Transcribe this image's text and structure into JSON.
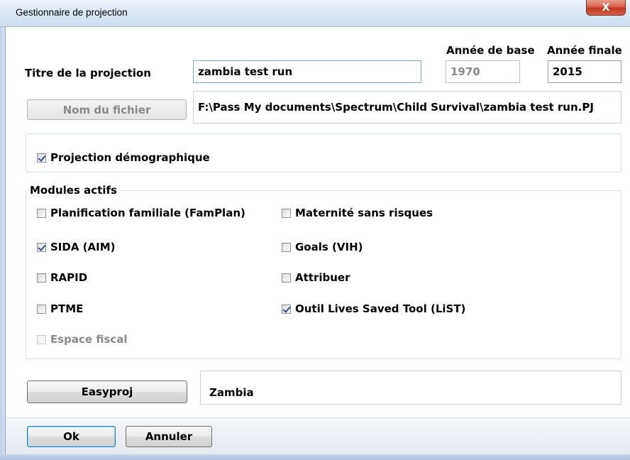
{
  "window": {
    "title": "Gestionnaire de projection",
    "close_glyph": "X"
  },
  "labels": {
    "projection_title": "Titre de la projection",
    "base_year": "Année de base",
    "final_year": "Année finale",
    "modules_group": "Modules actifs"
  },
  "fields": {
    "projection_title": "zambia test run",
    "base_year": "1970",
    "final_year": "2015",
    "file_path": "F:\\Pass My documents\\Spectrum\\Child Survival\\zambia test run.PJ",
    "country": "Zambia"
  },
  "buttons": {
    "file_name": "Nom du fichier",
    "easyproj": "Easyproj",
    "ok": "Ok",
    "cancel": "Annuler"
  },
  "demographic": {
    "label": "Projection démographique",
    "checked": true
  },
  "modules": {
    "famplan": {
      "label": "Planification familiale (FamPlan)",
      "checked": false
    },
    "aim": {
      "label": "SIDA (AIM)",
      "checked": true
    },
    "rapid": {
      "label": "RAPID",
      "checked": false
    },
    "ptme": {
      "label": "PTME",
      "checked": false
    },
    "fiscal": {
      "label": "Espace fiscal",
      "checked": false
    },
    "safe_motherhood": {
      "label": "Maternité sans risques",
      "checked": false
    },
    "goals": {
      "label": "Goals (VIH)",
      "checked": false
    },
    "allocate": {
      "label": "Attribuer",
      "checked": false
    },
    "list": {
      "label": "Outil Lives Saved Tool (LiST)",
      "checked": true
    }
  }
}
